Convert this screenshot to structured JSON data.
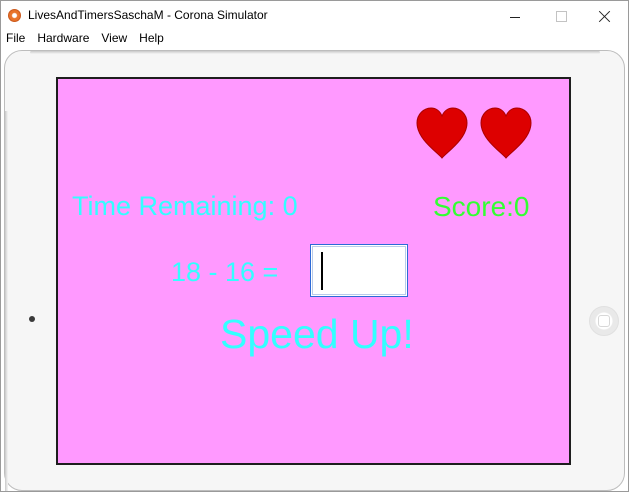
{
  "window": {
    "title": "LivesAndTimersSaschaM - Corona Simulator"
  },
  "menubar": {
    "items": [
      "File",
      "Hardware",
      "View",
      "Help"
    ]
  },
  "game": {
    "time_remaining": "Time Remaining: 0",
    "score": "Score:0",
    "question": "18 - 16 =",
    "answer_value": "",
    "message": "Speed Up!",
    "lives_remaining": 2
  },
  "colors": {
    "screen_background": "#ff99ff",
    "text_cyan": "#33ffff",
    "score_green": "#33ff33",
    "heart_red": "#dd0000"
  },
  "icons": {
    "app": "corona-app-icon",
    "lives": "heart-icon"
  }
}
